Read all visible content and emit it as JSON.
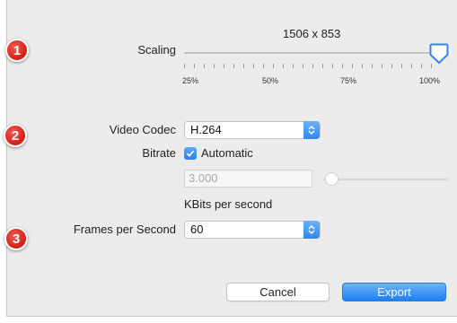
{
  "markers": [
    "1",
    "2",
    "3"
  ],
  "scaling": {
    "label": "Scaling",
    "resolution": "1506 x 853",
    "value_percent": 100,
    "tick_labels": [
      "25%",
      "50%",
      "75%",
      "100%"
    ]
  },
  "video_codec": {
    "label": "Video Codec",
    "value": "H.264"
  },
  "bitrate": {
    "label": "Bitrate",
    "automatic_label": "Automatic",
    "automatic_checked": true,
    "value": "3.000",
    "unit": "KBits per second"
  },
  "frames_per_second": {
    "label": "Frames per Second",
    "value": "60"
  },
  "buttons": {
    "cancel": "Cancel",
    "export": "Export"
  },
  "colors": {
    "accent": "#2f86f2",
    "marker": "#d9251c",
    "dialog_background": "#ececec"
  }
}
